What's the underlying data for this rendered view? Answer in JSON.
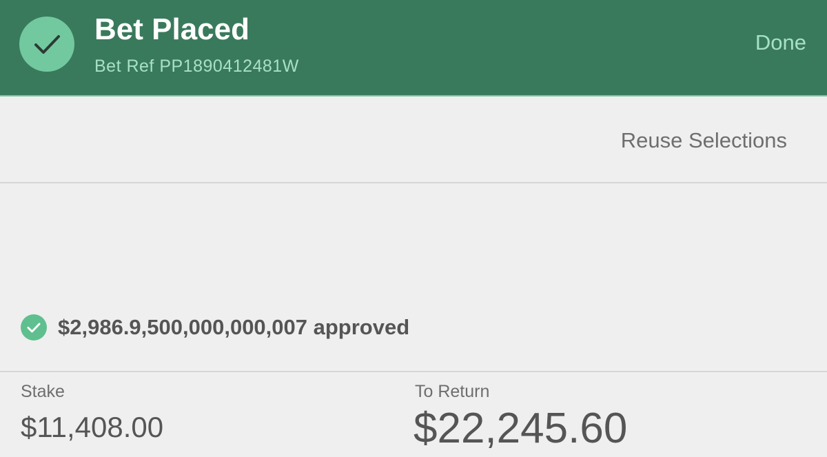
{
  "header": {
    "title": "Bet Placed",
    "bet_ref": "Bet Ref PP1890412481W",
    "done_label": "Done",
    "status_icon": "check-circle-icon",
    "background_color": "#3a7a5c",
    "accent_color": "#72c9a0"
  },
  "actions": {
    "reuse_label": "Reuse Selections"
  },
  "approval": {
    "icon": "check-circle-icon",
    "text": "$2,986.9,500,000,000,007 approved",
    "icon_color": "#5fbf8f"
  },
  "summary": {
    "stake_label": "Stake",
    "stake_value": "$11,408.00",
    "return_label": "To Return",
    "return_value": "$22,245.60"
  }
}
